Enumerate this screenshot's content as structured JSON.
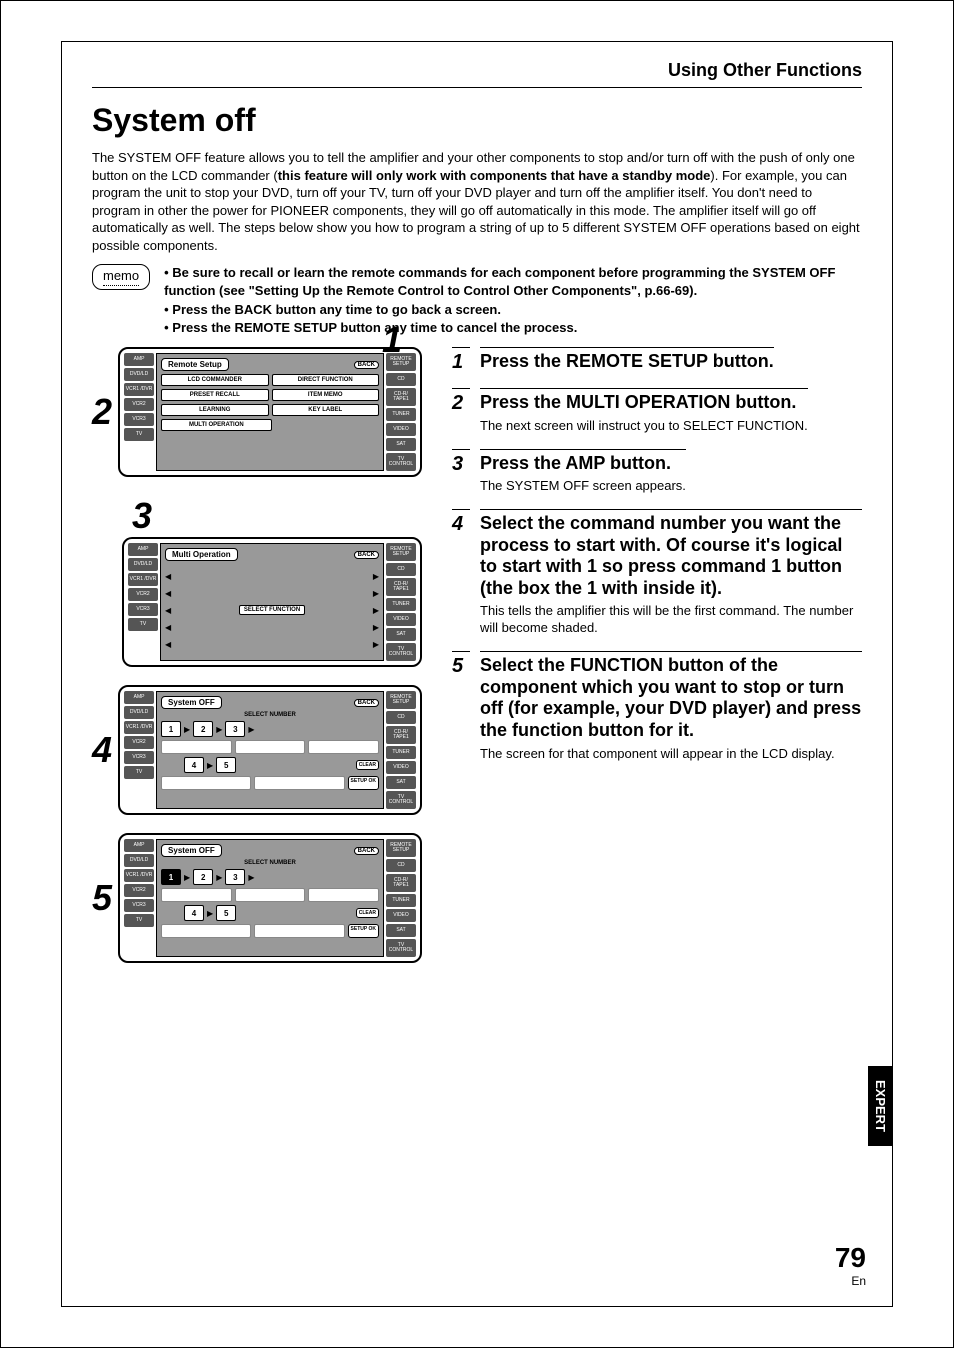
{
  "section_header": "Using Other Functions",
  "title": "System off",
  "intro": {
    "p1a": "The SYSTEM OFF feature allows you to tell the amplifier and your other components to stop and/or turn off with the push of only one button on the LCD commander (",
    "p1b_bold": "this feature will only work with components that have a standby mode",
    "p1c": "). For example, you can program the unit to stop your DVD, turn off your TV, turn off your DVD player and turn off the amplifier itself.  You don't need to program in other the power for PIONEER components, they will go off automatically in this mode. The amplifier itself will go off automatically as well. The steps below show you how to program a string of up to 5 different SYSTEM OFF operations based on eight possible components."
  },
  "memo_label": "memo",
  "memo": [
    "Be sure to recall or learn the remote commands for each component before programming the SYSTEM OFF function (see \"Setting Up the Remote Control to Control Other Components\", p.66-69).",
    "Press the BACK button any time to go back a screen.",
    "Press the REMOTE SETUP button any time to cancel the process."
  ],
  "side_buttons_left": [
    "AMP",
    "DVD/LD",
    "VCR1 /DVR",
    "VCR2",
    "VCR3",
    "TV"
  ],
  "side_buttons_right": [
    "REMOTE SETUP",
    "CD",
    "CD-R/ TAPE1",
    "TUNER",
    "VIDEO",
    "SAT",
    "TV CONTROL"
  ],
  "fig1": {
    "callout_top": "1",
    "callout_left": "2",
    "title": "Remote Setup",
    "back": "BACK",
    "buttons": [
      "LCD COMMANDER",
      "DIRECT FUNCTION",
      "PRESET RECALL",
      "ITEM MEMO",
      "LEARNING",
      "KEY LABEL",
      "MULTI OPERATION"
    ]
  },
  "fig3": {
    "callout": "3",
    "title": "Multi Operation",
    "back": "BACK",
    "select": "SELECT FUNCTION"
  },
  "fig4": {
    "callout": "4",
    "title": "System OFF",
    "back": "BACK",
    "select_label": "SELECT NUMBER",
    "numbers": [
      "1",
      "2",
      "3",
      "4",
      "5"
    ],
    "clear": "CLEAR",
    "setup": "SETUP OK"
  },
  "fig5": {
    "callout": "5",
    "title": "System OFF",
    "back": "BACK",
    "select_label": "SELECT NUMBER",
    "numbers": [
      "1",
      "2",
      "3",
      "4",
      "5"
    ],
    "selected": "1",
    "clear": "CLEAR",
    "setup": "SETUP OK"
  },
  "steps": [
    {
      "n": "1",
      "head": "Press the REMOTE SETUP button.",
      "desc": ""
    },
    {
      "n": "2",
      "head": "Press the MULTI OPERATION button.",
      "desc": "The next screen will instruct you to SELECT FUNCTION."
    },
    {
      "n": "3",
      "head": "Press the AMP button.",
      "desc": "The SYSTEM OFF screen appears."
    },
    {
      "n": "4",
      "head": "Select the command number you want the process to start with. Of course it's logical to start with 1 so press command 1 button (the box the 1 with inside it).",
      "desc": "This tells the amplifier this will be the first command. The number will become shaded."
    },
    {
      "n": "5",
      "head": "Select the FUNCTION button of the component which you want to stop or turn off (for example, your DVD player) and press the function button for it.",
      "desc": "The screen for that component will appear in the LCD display."
    }
  ],
  "side_tab": "EXPERT",
  "page_number": "79",
  "page_lang": "En"
}
